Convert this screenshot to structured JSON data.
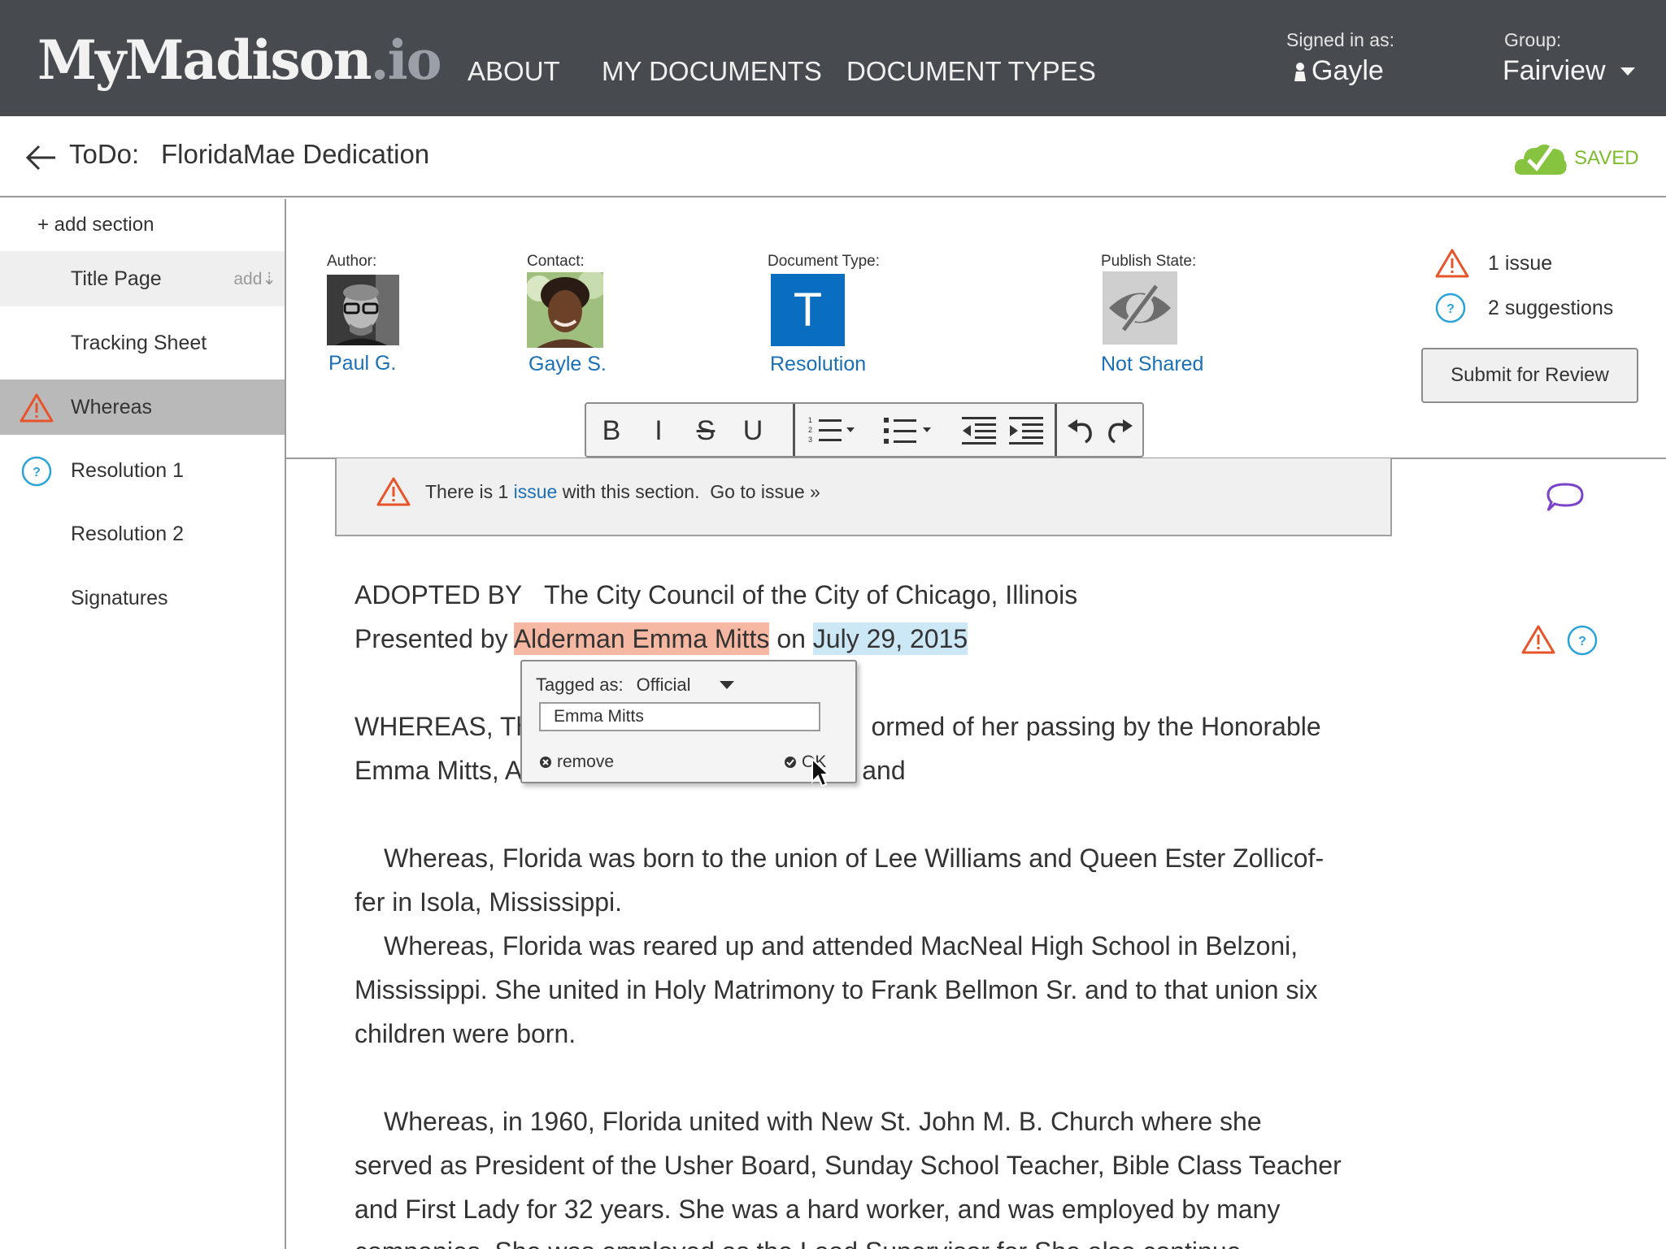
{
  "header": {
    "logo_main": "MyMadison",
    "logo_tld": ".io",
    "nav": [
      "ABOUT",
      "MY DOCUMENTS",
      "DOCUMENT TYPES"
    ],
    "signed_in_label": "Signed in as:",
    "signed_in_user": "Gayle",
    "group_label": "Group:",
    "group_value": "Fairview"
  },
  "title_row": {
    "prefix": "ToDo:",
    "title": "FloridaMae Dedication",
    "saved_label": "SAVED"
  },
  "sidebar": {
    "add_section": "+ add section",
    "items": [
      {
        "label": "Title Page",
        "extra": "add⇣"
      },
      {
        "label": "Tracking Sheet"
      },
      {
        "label": "Whereas",
        "icon": "warning-icon"
      },
      {
        "label": "Resolution 1",
        "icon": "question-icon"
      },
      {
        "label": "Resolution 2"
      },
      {
        "label": "Signatures"
      }
    ]
  },
  "meta": {
    "author_label": "Author:",
    "author_name": "Paul G.",
    "contact_label": "Contact:",
    "contact_name": "Gayle S.",
    "doctype_label": "Document Type:",
    "doctype_letter": "T",
    "doctype_name": "Resolution",
    "publish_label": "Publish State:",
    "publish_value": "Not Shared"
  },
  "status": {
    "issues": "1 issue",
    "suggestions": "2 suggestions",
    "submit": "Submit for Review"
  },
  "toolbar": {
    "bold": "B",
    "italic": "I",
    "strike": "S",
    "underline": "U"
  },
  "issue_banner": {
    "text_before": "There is 1 ",
    "issue_word": "issue",
    "text_after": " with this section.",
    "goto": "Go to issue »"
  },
  "document": {
    "adopted_by_label": "ADOPTED BY",
    "adopted_by_value": "The City Council of the City of Chicago, Illinois",
    "presented_by_label": "Presented by",
    "official_tag": "Alderman Emma Mitts",
    "on_word": "on",
    "date_tag": "July 29, 2015",
    "whereas1_a": "WHEREAS, Thi",
    "whereas1_b": "ormed of her passing by the Honorable",
    "whereas1_c": "Emma Mitts, A",
    "whereas1_d": "and",
    "para2_l1": "Whereas,  Florida was born to the union of Lee Williams and Queen Ester Zollicof-",
    "para2_l2": "fer in Isola, Mississippi.",
    "para3_l1": "Whereas,  Florida  was reared up and attended MacNeal High School in Belzoni,",
    "para3_l2": "Mississippi.  She united in Holy Matrimony to Frank Bellmon Sr. and to that union six",
    "para3_l3": "children were born.",
    "para4_l1": "Whereas,   in 1960, Florida united with New St. John M. B.  Church where she",
    "para4_l2": "served as President of the Usher Board, Sunday School Teacher, Bible Class Teacher",
    "para4_l3": "and First Lady for 32 years.  She was a hard worker, and was employed by many",
    "para4_l4": "companies.  She was employed as the Lead Supervisor for  She  also  continue"
  },
  "tag_popup": {
    "tagged_as_label": "Tagged as:",
    "tag_type": "Official",
    "input_value": "Emma Mitts",
    "remove": "remove",
    "ok": "OK"
  },
  "colors": {
    "topbar": "#474b4f",
    "link_blue": "#1b6fb5",
    "warning": "#e8542a",
    "suggestion": "#2aa3d8",
    "saved_green": "#7dbb2f",
    "official_highlight": "#f6b8a3",
    "date_highlight": "#cce7f5"
  }
}
